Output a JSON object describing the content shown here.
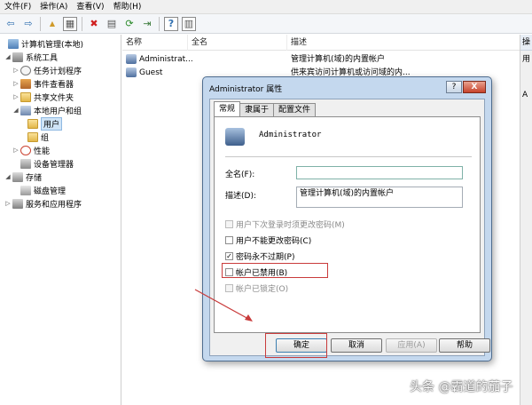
{
  "menubar": {
    "items": [
      {
        "label": "文件(F)"
      },
      {
        "label": "操作(A)"
      },
      {
        "label": "查看(V)"
      },
      {
        "label": "帮助(H)"
      }
    ]
  },
  "toolbar": {
    "buttons": [
      {
        "icon": "back-arrow-icon",
        "glyph": "⇦"
      },
      {
        "icon": "forward-arrow-icon",
        "glyph": "⇨"
      },
      {
        "icon": "up-folder-icon",
        "glyph": "▲"
      },
      {
        "icon": "show-hide-tree-icon",
        "glyph": "▦"
      },
      {
        "icon": "delete-icon",
        "glyph": "✖"
      },
      {
        "icon": "properties-icon",
        "glyph": "▤"
      },
      {
        "icon": "refresh-icon",
        "glyph": "⟳"
      },
      {
        "icon": "export-list-icon",
        "glyph": "⇥"
      },
      {
        "icon": "help-icon",
        "glyph": "?"
      },
      {
        "icon": "show-action-pane-icon",
        "glyph": "▥"
      }
    ]
  },
  "tree": {
    "nodes": [
      {
        "label": "计算机管理(本地)",
        "icon": "computer-icon",
        "level": 0,
        "expander": ""
      },
      {
        "label": "系统工具",
        "icon": "system-tools-icon",
        "level": 1,
        "expander": "◢"
      },
      {
        "label": "任务计划程序",
        "icon": "task-scheduler-icon",
        "level": 2,
        "expander": "▷"
      },
      {
        "label": "事件查看器",
        "icon": "event-viewer-icon",
        "level": 2,
        "expander": "▷"
      },
      {
        "label": "共享文件夹",
        "icon": "shared-folder-icon",
        "level": 2,
        "expander": "▷"
      },
      {
        "label": "本地用户和组",
        "icon": "local-users-icon",
        "level": 2,
        "expander": "◢"
      },
      {
        "label": "用户",
        "icon": "folder-icon",
        "level": 3,
        "expander": "",
        "selected": true
      },
      {
        "label": "组",
        "icon": "folder-icon",
        "level": 3,
        "expander": ""
      },
      {
        "label": "性能",
        "icon": "performance-icon",
        "level": 2,
        "expander": "▷"
      },
      {
        "label": "设备管理器",
        "icon": "device-manager-icon",
        "level": 2,
        "expander": ""
      },
      {
        "label": "存储",
        "icon": "storage-icon",
        "level": 1,
        "expander": "◢"
      },
      {
        "label": "磁盘管理",
        "icon": "disk-management-icon",
        "level": 2,
        "expander": ""
      },
      {
        "label": "服务和应用程序",
        "icon": "services-icon",
        "level": 1,
        "expander": "▷"
      }
    ]
  },
  "list": {
    "columns": [
      {
        "label": "名称"
      },
      {
        "label": "全名"
      },
      {
        "label": "描述"
      }
    ],
    "rows": [
      {
        "name": "Administrat...",
        "fullname": "",
        "description": "管理计算机(域)的内置帐户"
      },
      {
        "name": "Guest",
        "fullname": "",
        "description": "供来宾访问计算机或访问域的内..."
      }
    ]
  },
  "actions_pane": {
    "header": "操",
    "items": [
      "用",
      "A"
    ]
  },
  "dialog": {
    "title": "Administrator 属性",
    "help_button": "?",
    "close_button": "X",
    "tabs": [
      {
        "label": "常规",
        "active": true
      },
      {
        "label": "隶属于",
        "active": false
      },
      {
        "label": "配置文件",
        "active": false
      }
    ],
    "username": "Administrator",
    "fullname_label": "全名(F):",
    "fullname_value": "",
    "description_label": "描述(D):",
    "description_value": "管理计算机(域)的内置帐户",
    "checkboxes": [
      {
        "label": "用户下次登录时须更改密码(M)",
        "checked": false,
        "disabled": true
      },
      {
        "label": "用户不能更改密码(C)",
        "checked": false,
        "disabled": false
      },
      {
        "label": "密码永不过期(P)",
        "checked": true,
        "disabled": false
      },
      {
        "label": "帐户已禁用(B)",
        "checked": false,
        "disabled": false,
        "highlighted": true
      },
      {
        "label": "帐户已锁定(O)",
        "checked": false,
        "disabled": true
      }
    ],
    "buttons": {
      "ok": "确定",
      "cancel": "取消",
      "apply": "应用(A)",
      "help": "帮助"
    }
  },
  "watermark": "头条 @霸道的茄子",
  "colors": {
    "annotation_red": "#c93b3b",
    "dialog_frame": "#c4d8ee",
    "selection": "#cfe4f7"
  }
}
